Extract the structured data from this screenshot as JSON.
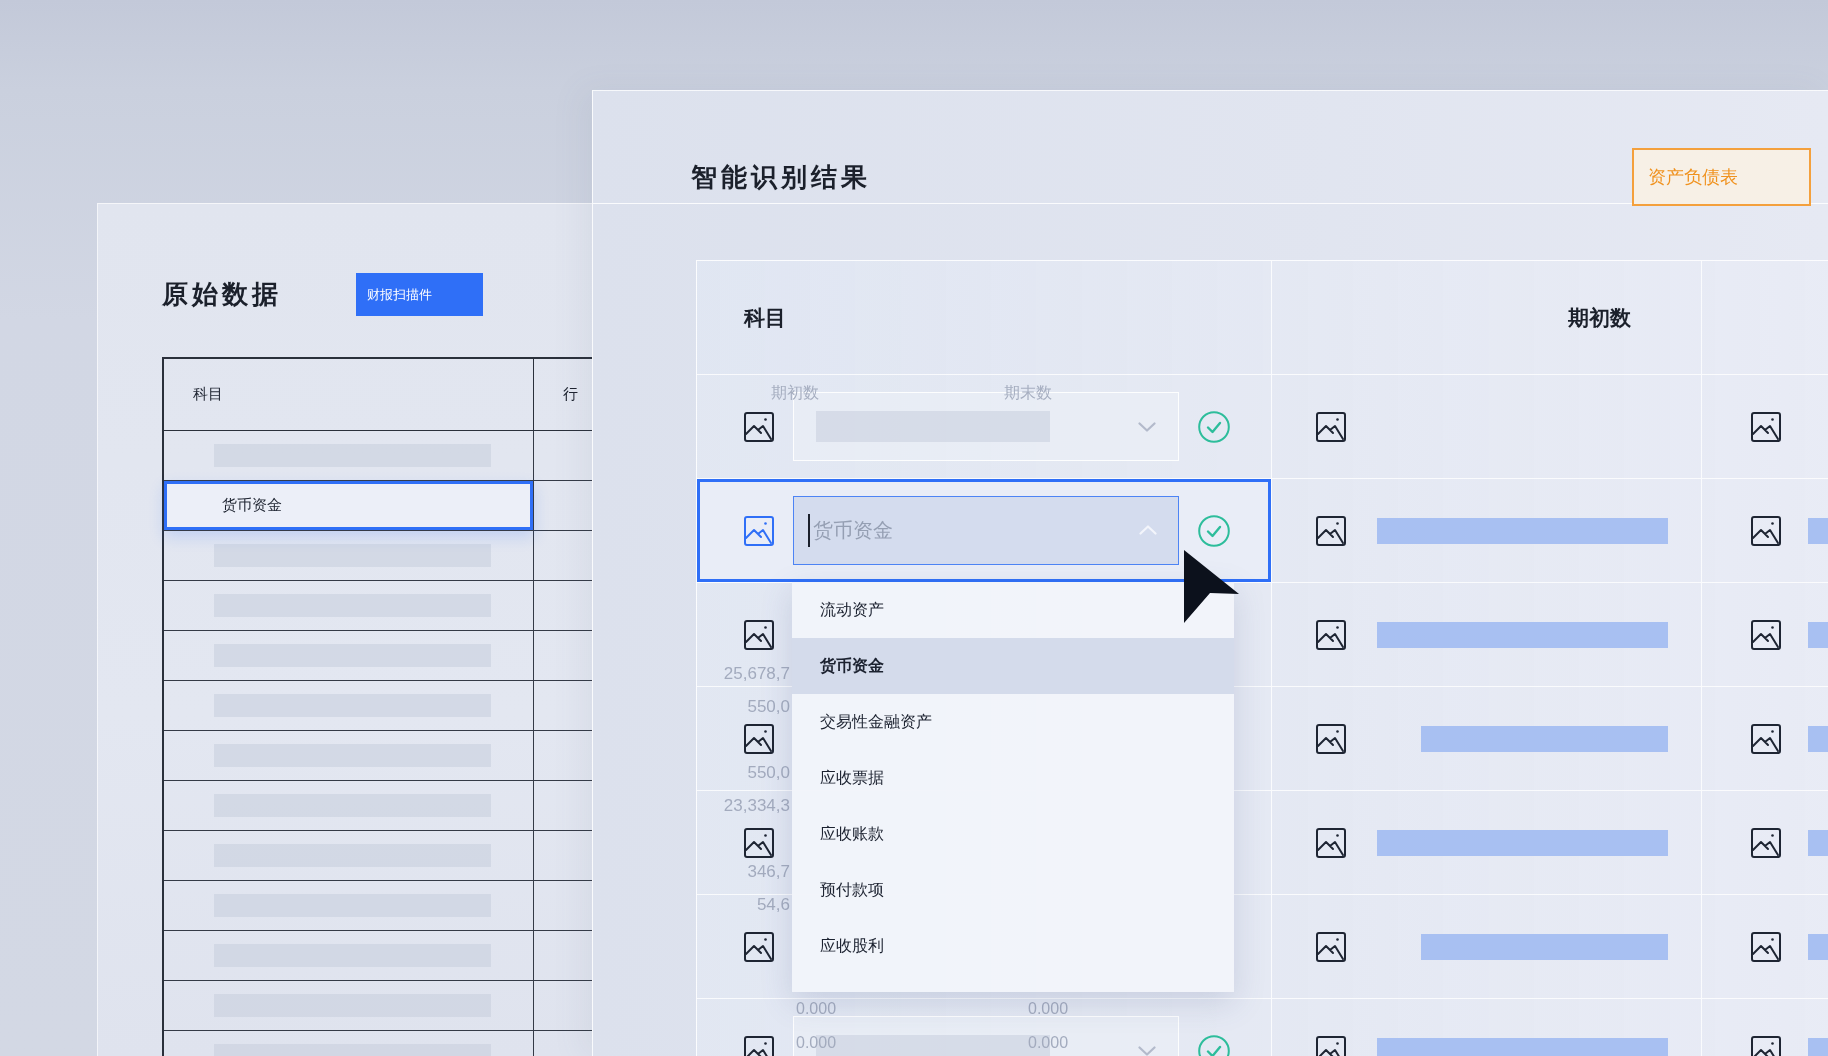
{
  "source_panel": {
    "title": "原始数据",
    "scan_button": "财报扫描件",
    "table": {
      "columns": [
        "科目",
        "行"
      ],
      "rows": [
        {
          "kind": "skeleton",
          "selected": false
        },
        {
          "kind": "text",
          "subject": "货币资金",
          "selected": true
        },
        {
          "kind": "skeleton",
          "selected": false
        },
        {
          "kind": "skeleton",
          "selected": false
        },
        {
          "kind": "skeleton",
          "selected": false
        },
        {
          "kind": "skeleton",
          "selected": false
        },
        {
          "kind": "skeleton",
          "selected": false
        },
        {
          "kind": "skeleton",
          "selected": false
        },
        {
          "kind": "skeleton",
          "selected": false
        },
        {
          "kind": "skeleton",
          "selected": false
        },
        {
          "kind": "skeleton",
          "selected": false
        },
        {
          "kind": "skeleton",
          "selected": false
        },
        {
          "kind": "skeleton",
          "selected": false
        }
      ]
    }
  },
  "result_panel": {
    "title": "智能识别结果",
    "statement_button": "资产负债表",
    "table": {
      "columns": [
        "科目",
        "期初数"
      ],
      "faded_sheet": {
        "columns": [
          "期初数",
          "期末数"
        ],
        "amounts": [
          "25,678,7",
          "550,0",
          "550,0",
          "23,334,3",
          "346,7",
          "54,6"
        ],
        "footer": [
          [
            "0.000",
            "0.000"
          ],
          [
            "0.000",
            "0.000"
          ]
        ]
      },
      "rows": [
        {
          "selected": false,
          "subject": {
            "kind": "collapsed",
            "verified": true
          },
          "opening": {
            "kind": "empty"
          },
          "closing": {
            "kind": "empty"
          }
        },
        {
          "selected": true,
          "subject": {
            "kind": "expanded",
            "placeholder": "货币资金",
            "verified": true,
            "options": [
              {
                "label": "流动资产",
                "selected": false
              },
              {
                "label": "货币资金",
                "selected": true
              },
              {
                "label": "交易性金融资产",
                "selected": false
              },
              {
                "label": "应收票据",
                "selected": false
              },
              {
                "label": "应收账款",
                "selected": false
              },
              {
                "label": "预付款项",
                "selected": false
              },
              {
                "label": "应收股利",
                "selected": false
              }
            ]
          },
          "opening": {
            "kind": "wide_bar"
          },
          "closing": {
            "kind": "wide_bar"
          }
        },
        {
          "selected": false,
          "subject": {
            "kind": "covered"
          },
          "opening": {
            "kind": "wide_bar"
          },
          "closing": {
            "kind": "wide_bar"
          }
        },
        {
          "selected": false,
          "subject": {
            "kind": "covered"
          },
          "opening": {
            "kind": "narrow_bar"
          },
          "closing": {
            "kind": "wide_bar"
          }
        },
        {
          "selected": false,
          "subject": {
            "kind": "covered"
          },
          "opening": {
            "kind": "wide_bar"
          },
          "closing": {
            "kind": "wide_bar"
          }
        },
        {
          "selected": false,
          "subject": {
            "kind": "covered"
          },
          "opening": {
            "kind": "narrow_bar"
          },
          "closing": {
            "kind": "wide_bar"
          }
        },
        {
          "selected": false,
          "subject": {
            "kind": "collapsed",
            "verified": true
          },
          "opening": {
            "kind": "wide_bar"
          },
          "closing": {
            "kind": "wide_bar"
          }
        }
      ]
    }
  }
}
